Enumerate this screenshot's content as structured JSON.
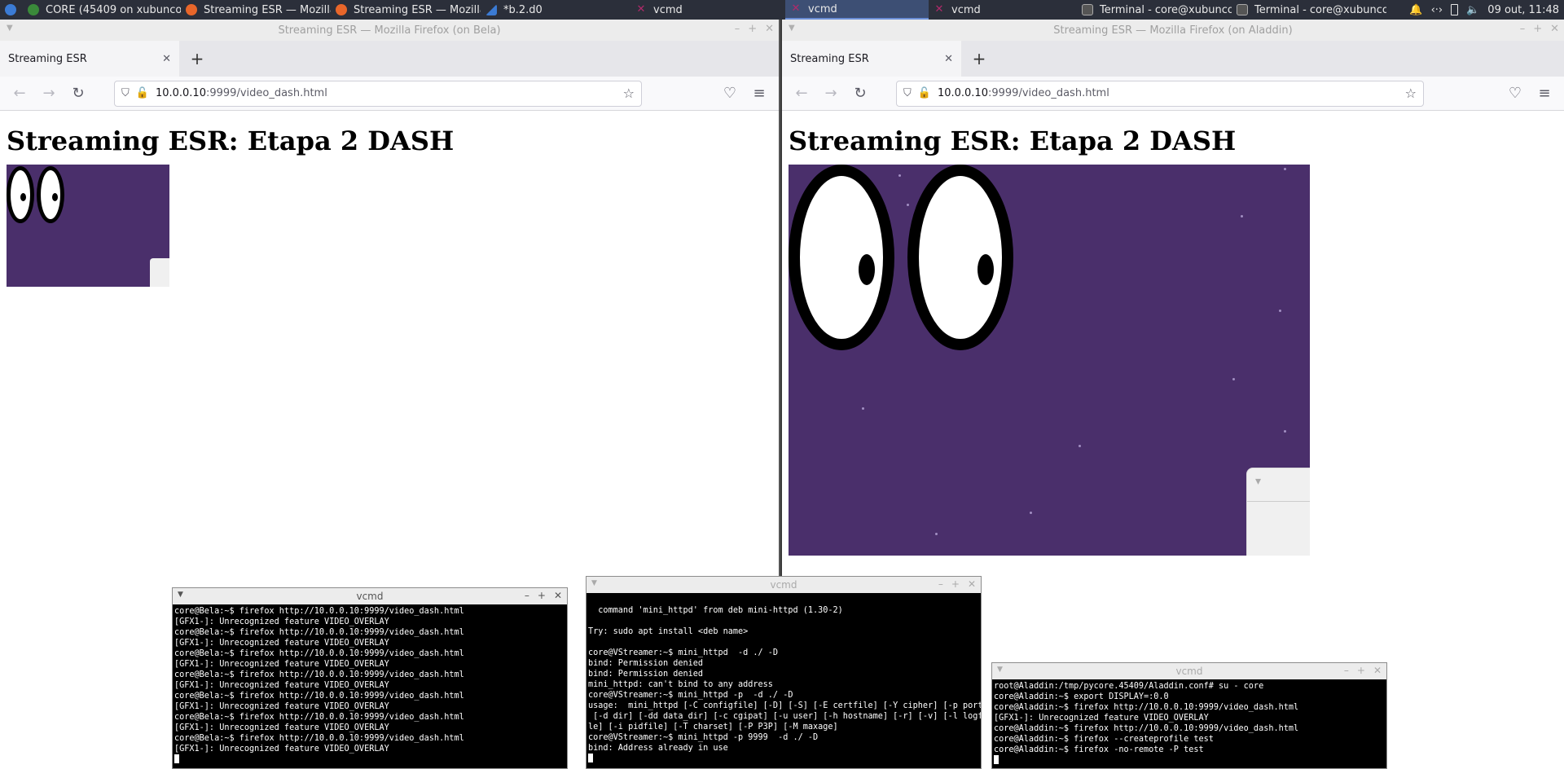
{
  "taskbar": {
    "items": [
      {
        "label": "CORE (45409 on xubuncor...",
        "icon": "core-icon",
        "color": "#3a8a3a"
      },
      {
        "label": "Streaming ESR — Mozilla ...",
        "icon": "firefox-icon",
        "color": "#e8662a"
      },
      {
        "label": "Streaming ESR — Mozilla ...",
        "icon": "firefox-icon",
        "color": "#e8662a"
      },
      {
        "label": "*b.2.d0",
        "icon": "wireshark-icon",
        "color": "#3b7bd4"
      },
      {
        "label": "vcmd",
        "icon": "vcmd-icon",
        "color": "#b02a6a"
      },
      {
        "label": "vcmd",
        "icon": "vcmd-icon",
        "color": "#b02a6a"
      },
      {
        "label": "vcmd",
        "icon": "vcmd-icon",
        "color": "#b02a6a"
      },
      {
        "label": "Terminal - core@xubunco...",
        "icon": "terminal-icon",
        "color": "#444444"
      },
      {
        "label": "Terminal - core@xubunco...",
        "icon": "terminal-icon",
        "color": "#444444"
      }
    ],
    "clock": "09 out, 11:48"
  },
  "windows": {
    "bela": {
      "title": "Streaming ESR — Mozilla Firefox (on Bela)",
      "tab_label": "Streaming ESR",
      "url_host": "10.0.0.10",
      "url_path": ":9999/video_dash.html",
      "heading": "Streaming ESR: Etapa 2 DASH"
    },
    "aladdin": {
      "title": "Streaming ESR — Mozilla Firefox (on Aladdin)",
      "tab_label": "Streaming ESR",
      "url_host": "10.0.0.10",
      "url_path": ":9999/video_dash.html",
      "heading": "Streaming ESR: Etapa 2 DASH"
    }
  },
  "terminals": {
    "t1": {
      "title": "vcmd",
      "lines": [
        "core@Bela:~$ firefox http://10.0.0.10:9999/video_dash.html",
        "[GFX1-]: Unrecognized feature VIDEO_OVERLAY",
        "core@Bela:~$ firefox http://10.0.0.10:9999/video_dash.html",
        "[GFX1-]: Unrecognized feature VIDEO_OVERLAY",
        "core@Bela:~$ firefox http://10.0.0.10:9999/video_dash.html",
        "[GFX1-]: Unrecognized feature VIDEO_OVERLAY",
        "core@Bela:~$ firefox http://10.0.0.10:9999/video_dash.html",
        "[GFX1-]: Unrecognized feature VIDEO_OVERLAY",
        "core@Bela:~$ firefox http://10.0.0.10:9999/video_dash.html",
        "[GFX1-]: Unrecognized feature VIDEO_OVERLAY",
        "core@Bela:~$ firefox http://10.0.0.10:9999/video_dash.html",
        "[GFX1-]: Unrecognized feature VIDEO_OVERLAY",
        "core@Bela:~$ firefox http://10.0.0.10:9999/video_dash.html",
        "[GFX1-]: Unrecognized feature VIDEO_OVERLAY"
      ]
    },
    "t2": {
      "title": "vcmd",
      "lines": [
        "",
        "  command 'mini_httpd' from deb mini-httpd (1.30-2)",
        "",
        "Try: sudo apt install <deb name>",
        "",
        "core@VStreamer:~$ mini_httpd  -d ./ -D",
        "bind: Permission denied",
        "bind: Permission denied",
        "mini_httpd: can't bind to any address",
        "core@VStreamer:~$ mini_httpd -p  -d ./ -D",
        "usage:  mini_httpd [-C configfile] [-D] [-S] [-E certfile] [-Y cipher] [-p port]",
        " [-d dir] [-dd data_dir] [-c cgipat] [-u user] [-h hostname] [-r] [-v] [-l logfi",
        "le] [-i pidfile] [-T charset] [-P P3P] [-M maxage]",
        "core@VStreamer:~$ mini_httpd -p 9999  -d ./ -D",
        "bind: Address already in use"
      ]
    },
    "t3": {
      "title": "vcmd",
      "lines": [
        "root@Aladdin:/tmp/pycore.45409/Aladdin.conf# su - core",
        "core@Aladdin:~$ export DISPLAY=:0.0",
        "core@Aladdin:~$ firefox http://10.0.0.10:9999/video_dash.html",
        "[GFX1-]: Unrecognized feature VIDEO_OVERLAY",
        "core@Aladdin:~$ firefox http://10.0.0.10:9999/video_dash.html",
        "core@Aladdin:~$ firefox --createprofile test",
        "core@Aladdin:~$ firefox -no-remote -P test"
      ]
    }
  }
}
